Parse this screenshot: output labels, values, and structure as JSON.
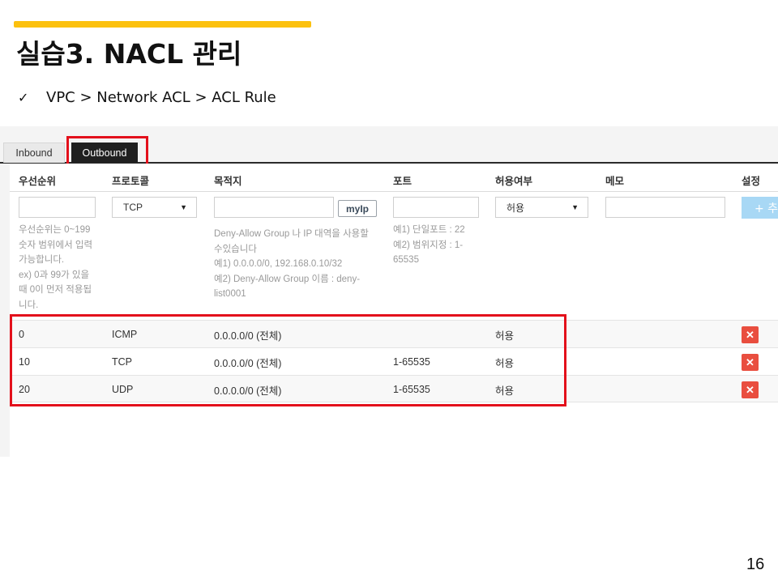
{
  "slide": {
    "title": "실습3. NACL 관리",
    "breadcrumb": {
      "check": "✓",
      "path": "VPC  >  Network ACL  >  ACL Rule"
    },
    "page_number": "16",
    "accent_color": "#fcc10f",
    "highlight_color": "#e3101b"
  },
  "tabs": [
    {
      "label": "Inbound",
      "active": false
    },
    {
      "label": "Outbound",
      "active": true
    }
  ],
  "table": {
    "columns": [
      "우선순위",
      "프로토콜",
      "목적지",
      "포트",
      "허용여부",
      "메모",
      "설정"
    ],
    "form": {
      "priority_value": "",
      "protocol_selected": "TCP",
      "destination_value": "",
      "myip_label": "myIp",
      "port_value": "",
      "allow_selected": "허용",
      "memo_value": "",
      "add_label": "+ 추"
    },
    "help": {
      "priority": "우선순위는 0~199\n숫자 범위에서 입력\n가능합니다.\nex) 0과 99가 있을\n때 0이 먼저 적용됩\n니다.",
      "destination": "Deny-Allow Group 나 IP 대역을 사용할\n수있습니다\n예1) 0.0.0.0/0, 192.168.0.10/32\n예2) Deny-Allow Group 이름 : deny-\nlist0001",
      "port": "예1) 단일포트 : 22\n예2) 범위지정 : 1-\n65535"
    },
    "rows": [
      {
        "priority": "0",
        "protocol": "ICMP",
        "destination": "0.0.0.0/0 (전체)",
        "port": "",
        "allow": "허용",
        "memo": "",
        "delete": "✕"
      },
      {
        "priority": "10",
        "protocol": "TCP",
        "destination": "0.0.0.0/0 (전체)",
        "port": "1-65535",
        "allow": "허용",
        "memo": "",
        "delete": "✕"
      },
      {
        "priority": "20",
        "protocol": "UDP",
        "destination": "0.0.0.0/0 (전체)",
        "port": "1-65535",
        "allow": "허용",
        "memo": "",
        "delete": "✕"
      }
    ]
  }
}
